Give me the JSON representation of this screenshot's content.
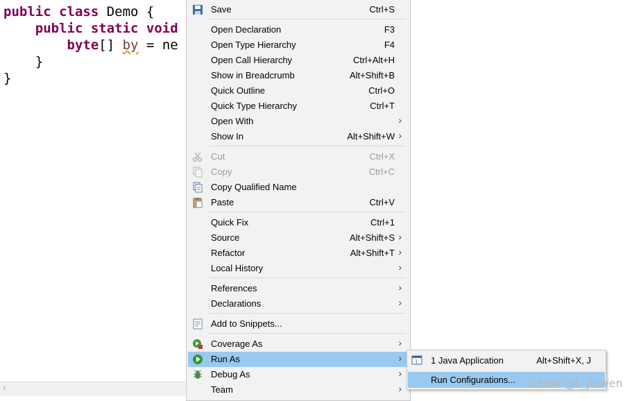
{
  "editor": {
    "line1_kw": "public class",
    "line1_rest": " Demo {",
    "line2_kw": "public static",
    "line2_rest": " void",
    "line3_kw": "byte",
    "line3_mid": "[] ",
    "line3_var": "by",
    "line3_rest": " = ne",
    "line4": "}",
    "line5": "}",
    "scroll_left": "‹"
  },
  "menu": {
    "save": {
      "label": "Save",
      "shortcut": "Ctrl+S"
    },
    "open_declaration": {
      "label": "Open Declaration",
      "shortcut": "F3"
    },
    "open_type_hierarchy": {
      "label": "Open Type Hierarchy",
      "shortcut": "F4"
    },
    "open_call_hierarchy": {
      "label": "Open Call Hierarchy",
      "shortcut": "Ctrl+Alt+H"
    },
    "show_in_breadcrumb": {
      "label": "Show in Breadcrumb",
      "shortcut": "Alt+Shift+B"
    },
    "quick_outline": {
      "label": "Quick Outline",
      "shortcut": "Ctrl+O"
    },
    "quick_type_hierarchy": {
      "label": "Quick Type Hierarchy",
      "shortcut": "Ctrl+T"
    },
    "open_with": {
      "label": "Open With",
      "shortcut": ""
    },
    "show_in": {
      "label": "Show In",
      "shortcut": "Alt+Shift+W"
    },
    "cut": {
      "label": "Cut",
      "shortcut": "Ctrl+X"
    },
    "copy": {
      "label": "Copy",
      "shortcut": "Ctrl+C"
    },
    "copy_qualified_name": {
      "label": "Copy Qualified Name",
      "shortcut": ""
    },
    "paste": {
      "label": "Paste",
      "shortcut": "Ctrl+V"
    },
    "quick_fix": {
      "label": "Quick Fix",
      "shortcut": "Ctrl+1"
    },
    "source": {
      "label": "Source",
      "shortcut": "Alt+Shift+S"
    },
    "refactor": {
      "label": "Refactor",
      "shortcut": "Alt+Shift+T"
    },
    "local_history": {
      "label": "Local History",
      "shortcut": ""
    },
    "references": {
      "label": "References",
      "shortcut": ""
    },
    "declarations": {
      "label": "Declarations",
      "shortcut": ""
    },
    "add_to_snippets": {
      "label": "Add to Snippets...",
      "shortcut": ""
    },
    "coverage_as": {
      "label": "Coverage As",
      "shortcut": ""
    },
    "run_as": {
      "label": "Run As",
      "shortcut": ""
    },
    "debug_as": {
      "label": "Debug As",
      "shortcut": ""
    },
    "team": {
      "label": "Team",
      "shortcut": ""
    },
    "submenu_arrow": "›"
  },
  "submenu": {
    "java_application": {
      "label": "1 Java Application",
      "shortcut": "Alt+Shift+X, J"
    },
    "run_configurations": {
      "label": "Run Configurations..."
    }
  },
  "watermark": "CSDN @L_Jiawen",
  "colors": {
    "highlight": "#99c9ef",
    "keyword": "#7f0055",
    "menu_bg": "#f2f2f2"
  }
}
